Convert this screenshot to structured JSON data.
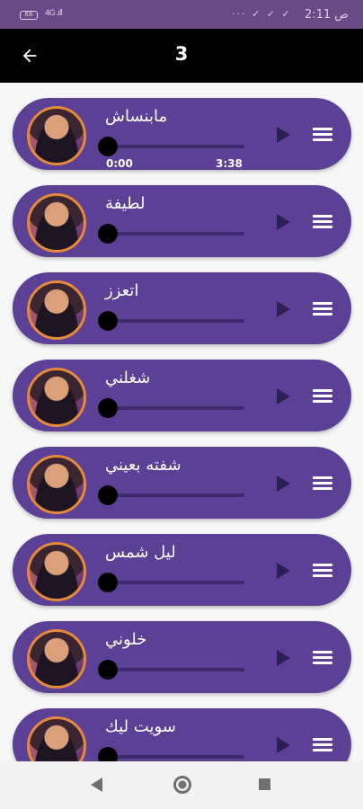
{
  "status_bar": {
    "time": "2:11",
    "am_pm": "ص",
    "battery": "68",
    "signal": "4G .ıll"
  },
  "header": {
    "title": "3"
  },
  "songs": [
    {
      "title": "مابنساش",
      "current_time": "0:00",
      "total_time": "3:38",
      "progress": 0
    },
    {
      "title": "لطيفة",
      "progress": 0
    },
    {
      "title": "اتعزز",
      "progress": 0
    },
    {
      "title": "شغلني",
      "progress": 0
    },
    {
      "title": "شفته بعيني",
      "progress": 0
    },
    {
      "title": "ليل شمس",
      "progress": 0
    },
    {
      "title": "خلوني",
      "progress": 0
    },
    {
      "title": "سويت ليك",
      "progress": 0
    }
  ],
  "colors": {
    "status_bar": "#6a4a86",
    "app_bar": "#000000",
    "card": "#5b4096",
    "track": "#3e2a6d",
    "thumb": "#000000"
  },
  "icons": {
    "back": "arrow-left-icon",
    "play": "play-icon",
    "menu": "menu-icon",
    "nav_back": "triangle-back-icon",
    "nav_home": "circle-home-icon",
    "nav_recent": "square-recents-icon"
  }
}
